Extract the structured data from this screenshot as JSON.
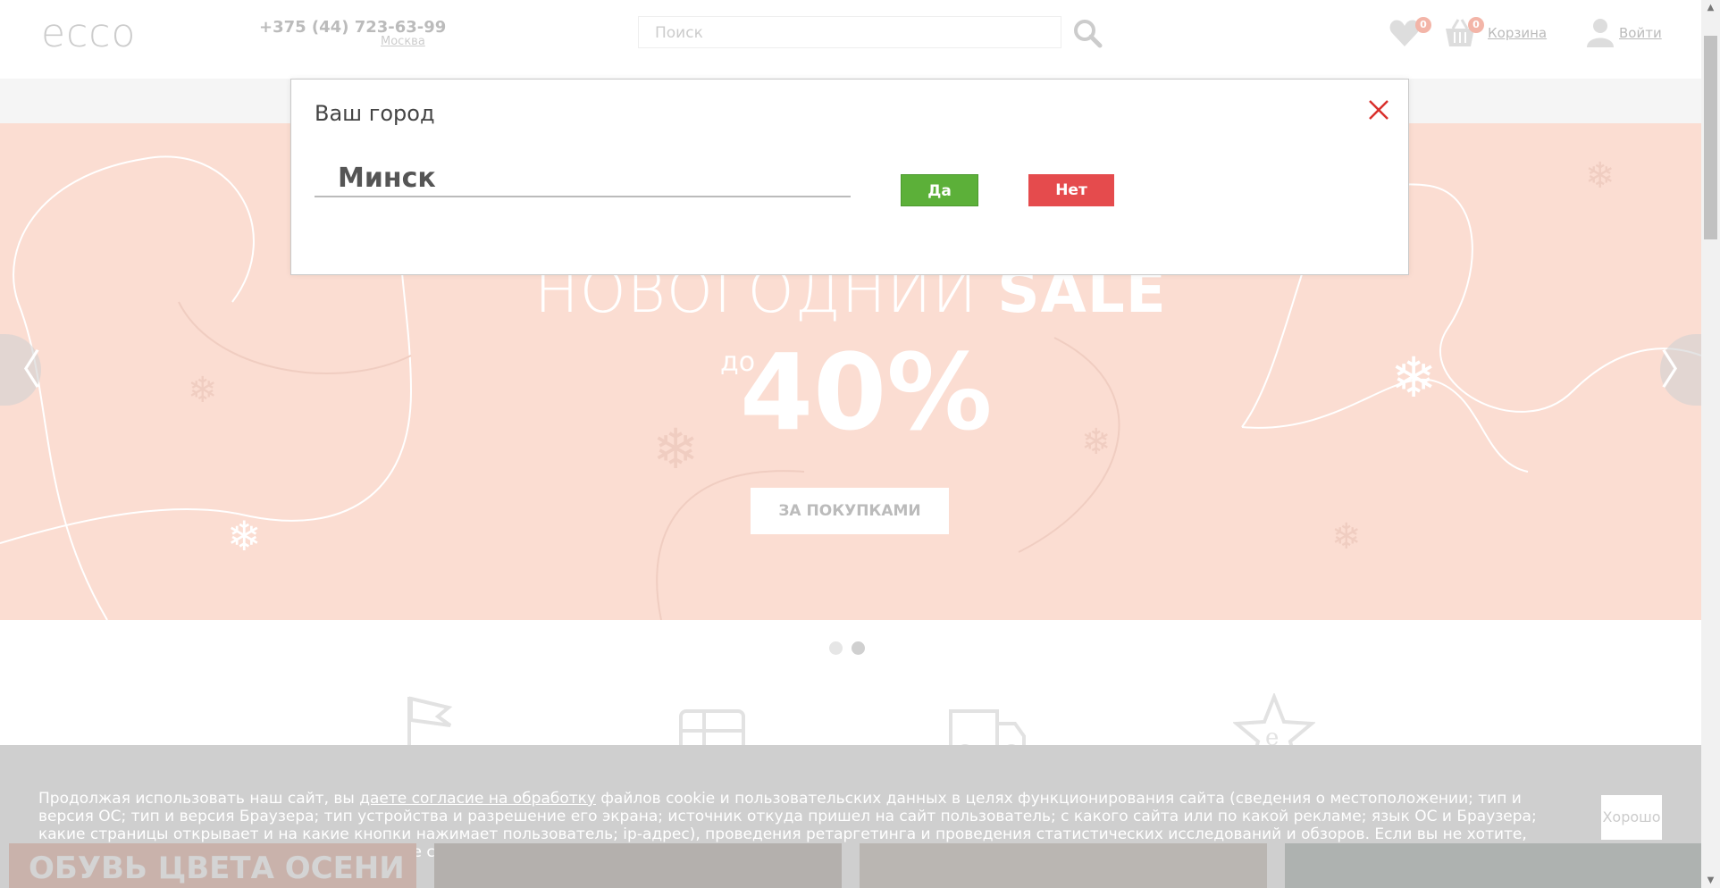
{
  "header": {
    "logo": "ecco",
    "phone": "+375 (44) 723-63-99",
    "phone_city": "Москва",
    "search_placeholder": "Поиск",
    "favorites_count": "0",
    "cart_count": "0",
    "cart_label": "Корзина",
    "login_label": "Войти"
  },
  "banner": {
    "title_light": "НОВОГОДНИЙ ",
    "title_bold": "SALE",
    "pre": "до",
    "percent": "40%",
    "button": "ЗА ПОКУПКАМИ",
    "prev_arrow": "〈",
    "next_arrow": "〉",
    "background_color": "#fbddd2"
  },
  "carousel": {
    "slides": 2,
    "active_index": 1
  },
  "features": [
    {
      "icon": "flag-icon"
    },
    {
      "icon": "gift-card-icon"
    },
    {
      "icon": "delivery-truck-icon"
    },
    {
      "icon": "star-e-icon"
    }
  ],
  "cookie": {
    "text_before": "Продолжая использовать наш сайт, вы ",
    "link": "даете согласие на обработку",
    "text_after": " файлов cookie и пользовательских данных в целях функционирования сайта (сведения о местоположении; тип и версия ОС; тип и версия Браузера; тип устройства и разрешение его экрана; источник откуда пришел на сайт пользователь; с какого сайта или по какой рекламе; язык ОС и Браузера; какие страницы открывает и на какие кнопки нажимает пользователь; ip-адрес), проведения ретаргетинга и проведения статистических исследований и обзоров. Если вы не хотите, чтобы ваши данные обрабатывались, покиньте сайт.",
    "ok_button": "Хорошо"
  },
  "promo_strip": {
    "first_tile_text": "ОБУВЬ ЦВЕТА ОСЕНИ"
  },
  "modal": {
    "title": "Ваш город",
    "city": "Минск",
    "yes": "Да",
    "no": "Нет",
    "yes_color": "#5cb039",
    "no_color": "#e54b4d",
    "close_color": "#d9302c"
  }
}
